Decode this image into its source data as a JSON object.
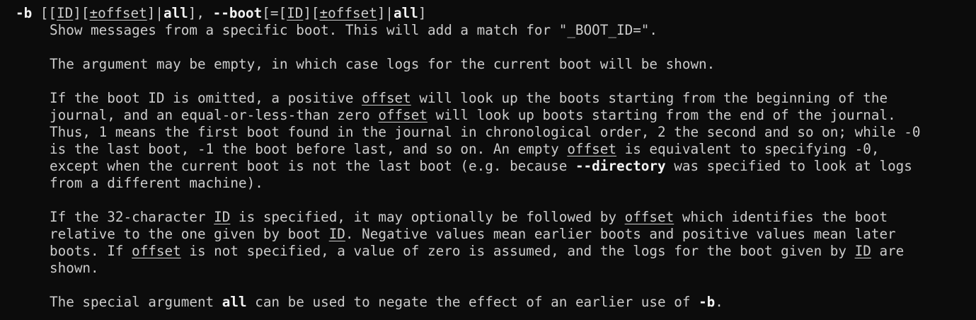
{
  "man_entry": {
    "option_line": [
      {
        "t": "-b",
        "s": "b"
      },
      {
        "t": " [["
      },
      {
        "t": "ID",
        "s": "u"
      },
      {
        "t": "]["
      },
      {
        "t": "±offset",
        "s": "u"
      },
      {
        "t": "]|"
      },
      {
        "t": "all",
        "s": "b"
      },
      {
        "t": "], "
      },
      {
        "t": "--boot",
        "s": "b"
      },
      {
        "t": "[=["
      },
      {
        "t": "ID",
        "s": "u"
      },
      {
        "t": "]["
      },
      {
        "t": "±offset",
        "s": "u"
      },
      {
        "t": "]|"
      },
      {
        "t": "all",
        "s": "b"
      },
      {
        "t": "]"
      }
    ],
    "lines": [
      [
        {
          "t": "Show messages from a specific boot. This will add a match for \"_BOOT_ID=\"."
        }
      ],
      [],
      [
        {
          "t": "The argument may be empty, in which case logs for the current boot will be shown."
        }
      ],
      [],
      [
        {
          "t": "If the boot ID is omitted, a positive "
        },
        {
          "t": "offset",
          "s": "u"
        },
        {
          "t": " will look up the boots starting from the beginning of the"
        }
      ],
      [
        {
          "t": "journal, and an equal-or-less-than zero "
        },
        {
          "t": "offset",
          "s": "u"
        },
        {
          "t": " will look up boots starting from the end of the journal."
        }
      ],
      [
        {
          "t": "Thus, 1 means the first boot found in the journal in chronological order, 2 the second and so on; while -0"
        }
      ],
      [
        {
          "t": "is the last boot, -1 the boot before last, and so on. An empty "
        },
        {
          "t": "offset",
          "s": "u"
        },
        {
          "t": " is equivalent to specifying -0,"
        }
      ],
      [
        {
          "t": "except when the current boot is not the last boot (e.g. because "
        },
        {
          "t": "--directory",
          "s": "b"
        },
        {
          "t": " was specified to look at logs"
        }
      ],
      [
        {
          "t": "from a different machine)."
        }
      ],
      [],
      [
        {
          "t": "If the 32-character "
        },
        {
          "t": "ID",
          "s": "u"
        },
        {
          "t": " is specified, it may optionally be followed by "
        },
        {
          "t": "offset",
          "s": "u"
        },
        {
          "t": " which identifies the boot"
        }
      ],
      [
        {
          "t": "relative to the one given by boot "
        },
        {
          "t": "ID",
          "s": "u"
        },
        {
          "t": ". Negative values mean earlier boots and positive values mean later"
        }
      ],
      [
        {
          "t": "boots. If "
        },
        {
          "t": "offset",
          "s": "u"
        },
        {
          "t": " is not specified, a value of zero is assumed, and the logs for the boot given by "
        },
        {
          "t": "ID",
          "s": "u"
        },
        {
          "t": " are"
        }
      ],
      [
        {
          "t": "shown."
        }
      ],
      [],
      [
        {
          "t": "The special argument "
        },
        {
          "t": "all",
          "s": "b"
        },
        {
          "t": " can be used to negate the effect of an earlier use of "
        },
        {
          "t": "-b",
          "s": "b"
        },
        {
          "t": "."
        }
      ]
    ]
  },
  "colors": {
    "background": "#0c0c0c",
    "text": "#cccccc",
    "bold_text": "#f2f2f2"
  }
}
